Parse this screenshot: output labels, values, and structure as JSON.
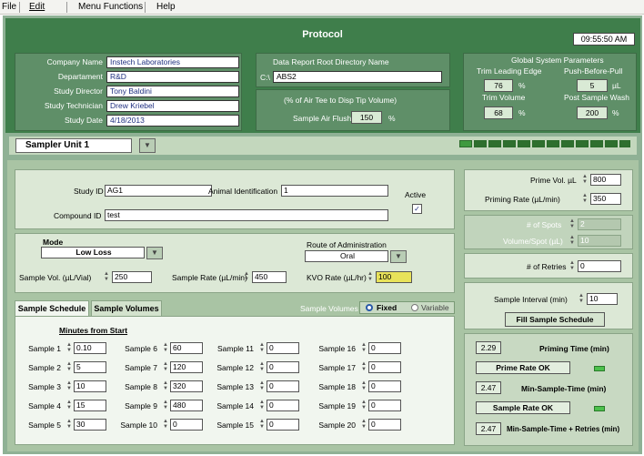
{
  "menu": {
    "file": "File",
    "edit": "Edit",
    "functions": "Menu Functions",
    "help": "Help"
  },
  "title": "Protocol",
  "clock": "09:55:50 AM",
  "company": {
    "company_name_label": "Company Name",
    "company_name": "Instech Laboratories",
    "department_label": "Departament",
    "department": "R&D",
    "director_label": "Study Director",
    "director": "Tony Baldini",
    "technician_label": "Study Technician",
    "technician": "Drew Kriebel",
    "date_label": "Study Date",
    "date": "4/18/2013"
  },
  "report": {
    "dir_label": "Data Report Root Directory Name",
    "dir_prefix": "C:\\",
    "dir_value": "ABS2",
    "air_note": "(% of Air Tee to Disp Tip Volume)",
    "air_flush_label": "Sample Air Flush",
    "air_flush_value": "150",
    "air_flush_unit": "%"
  },
  "global": {
    "title": "Global System Parameters",
    "trim_leading_label": "Trim Leading Edge",
    "trim_leading_value": "76",
    "trim_leading_unit": "%",
    "push_label": "Push-Before-Pull",
    "push_value": "5",
    "push_unit": "µL",
    "trim_volume_label": "Trim Volume",
    "trim_volume_value": "68",
    "trim_volume_unit": "%",
    "post_wash_label": "Post Sample Wash",
    "post_wash_value": "200",
    "post_wash_unit": "%"
  },
  "sampler": "Sampler Unit 1",
  "study": {
    "study_id_label": "Study ID",
    "study_id": "AG1",
    "animal_label": "Animal Identification",
    "animal": "1",
    "active_label": "Active",
    "active_check": "✓",
    "compound_label": "Compound ID",
    "compound": "test"
  },
  "mode": {
    "mode_label": "Mode",
    "mode_value": "Low Loss",
    "route_label": "Route of Administration",
    "route_value": "Oral",
    "vol_label": "Sample Vol. (µL/Vial)",
    "vol_value": "250",
    "rate_label": "Sample Rate (µL/min)",
    "rate_value": "450",
    "kvo_label": "KVO Rate (µL/hr)",
    "kvo_value": "100"
  },
  "tabs": {
    "schedule": "Sample Schedule",
    "volumes": "Sample Volumes",
    "volumes_label": "Sample Volumes",
    "fixed": "Fixed",
    "variable": "Variable"
  },
  "schedule": {
    "heading": "Minutes from Start",
    "samples": [
      {
        "label": "Sample 1",
        "value": "0.10"
      },
      {
        "label": "Sample 2",
        "value": "5"
      },
      {
        "label": "Sample 3",
        "value": "10"
      },
      {
        "label": "Sample 4",
        "value": "15"
      },
      {
        "label": "Sample 5",
        "value": "30"
      },
      {
        "label": "Sample 6",
        "value": "60"
      },
      {
        "label": "Sample 7",
        "value": "120"
      },
      {
        "label": "Sample 8",
        "value": "320"
      },
      {
        "label": "Sample 9",
        "value": "480"
      },
      {
        "label": "Sample 10",
        "value": "0"
      },
      {
        "label": "Sample 11",
        "value": "0"
      },
      {
        "label": "Sample 12",
        "value": "0"
      },
      {
        "label": "Sample 13",
        "value": "0"
      },
      {
        "label": "Sample 14",
        "value": "0"
      },
      {
        "label": "Sample 15",
        "value": "0"
      },
      {
        "label": "Sample 16",
        "value": "0"
      },
      {
        "label": "Sample 17",
        "value": "0"
      },
      {
        "label": "Sample 18",
        "value": "0"
      },
      {
        "label": "Sample 19",
        "value": "0"
      },
      {
        "label": "Sample 20",
        "value": "0"
      }
    ]
  },
  "right": {
    "prime_vol_label": "Prime Vol. µL",
    "prime_vol": "800",
    "priming_rate_label": "Priming Rate (µL/min)",
    "priming_rate": "350",
    "spots_label": "# of Spots",
    "spots": "2",
    "vol_spot_label": "Volume/Spot (µL)",
    "vol_spot": "10",
    "retries_label": "# of Retries",
    "retries": "0",
    "interval_label": "Sample Interval (min)",
    "interval": "10",
    "fill_button": "Fill Sample Schedule",
    "priming_time_value": "2.29",
    "priming_time_label": "Priming Time (min)",
    "prime_ok": "Prime Rate OK",
    "min_time_value": "2.47",
    "min_time_label": "Min-Sample-Time (min)",
    "sample_ok": "Sample Rate OK",
    "min_retries_value": "2.47",
    "min_retries_label": "Min-Sample-Time + Retries (min)"
  }
}
